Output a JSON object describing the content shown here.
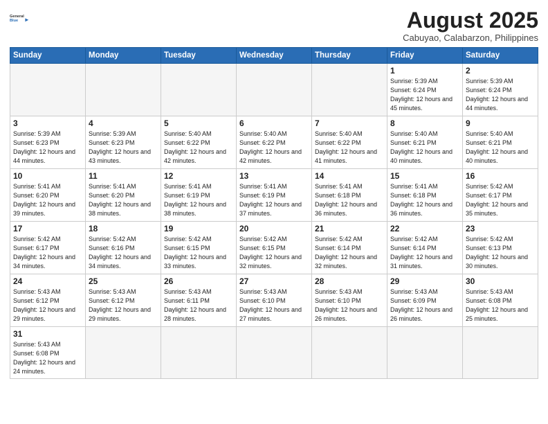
{
  "header": {
    "logo_general": "General",
    "logo_blue": "Blue",
    "title": "August 2025",
    "subtitle": "Cabuyao, Calabarzon, Philippines"
  },
  "weekdays": [
    "Sunday",
    "Monday",
    "Tuesday",
    "Wednesday",
    "Thursday",
    "Friday",
    "Saturday"
  ],
  "weeks": [
    [
      {
        "day": "",
        "info": ""
      },
      {
        "day": "",
        "info": ""
      },
      {
        "day": "",
        "info": ""
      },
      {
        "day": "",
        "info": ""
      },
      {
        "day": "",
        "info": ""
      },
      {
        "day": "1",
        "info": "Sunrise: 5:39 AM\nSunset: 6:24 PM\nDaylight: 12 hours\nand 45 minutes."
      },
      {
        "day": "2",
        "info": "Sunrise: 5:39 AM\nSunset: 6:24 PM\nDaylight: 12 hours\nand 44 minutes."
      }
    ],
    [
      {
        "day": "3",
        "info": "Sunrise: 5:39 AM\nSunset: 6:23 PM\nDaylight: 12 hours\nand 44 minutes."
      },
      {
        "day": "4",
        "info": "Sunrise: 5:39 AM\nSunset: 6:23 PM\nDaylight: 12 hours\nand 43 minutes."
      },
      {
        "day": "5",
        "info": "Sunrise: 5:40 AM\nSunset: 6:22 PM\nDaylight: 12 hours\nand 42 minutes."
      },
      {
        "day": "6",
        "info": "Sunrise: 5:40 AM\nSunset: 6:22 PM\nDaylight: 12 hours\nand 42 minutes."
      },
      {
        "day": "7",
        "info": "Sunrise: 5:40 AM\nSunset: 6:22 PM\nDaylight: 12 hours\nand 41 minutes."
      },
      {
        "day": "8",
        "info": "Sunrise: 5:40 AM\nSunset: 6:21 PM\nDaylight: 12 hours\nand 40 minutes."
      },
      {
        "day": "9",
        "info": "Sunrise: 5:40 AM\nSunset: 6:21 PM\nDaylight: 12 hours\nand 40 minutes."
      }
    ],
    [
      {
        "day": "10",
        "info": "Sunrise: 5:41 AM\nSunset: 6:20 PM\nDaylight: 12 hours\nand 39 minutes."
      },
      {
        "day": "11",
        "info": "Sunrise: 5:41 AM\nSunset: 6:20 PM\nDaylight: 12 hours\nand 38 minutes."
      },
      {
        "day": "12",
        "info": "Sunrise: 5:41 AM\nSunset: 6:19 PM\nDaylight: 12 hours\nand 38 minutes."
      },
      {
        "day": "13",
        "info": "Sunrise: 5:41 AM\nSunset: 6:19 PM\nDaylight: 12 hours\nand 37 minutes."
      },
      {
        "day": "14",
        "info": "Sunrise: 5:41 AM\nSunset: 6:18 PM\nDaylight: 12 hours\nand 36 minutes."
      },
      {
        "day": "15",
        "info": "Sunrise: 5:41 AM\nSunset: 6:18 PM\nDaylight: 12 hours\nand 36 minutes."
      },
      {
        "day": "16",
        "info": "Sunrise: 5:42 AM\nSunset: 6:17 PM\nDaylight: 12 hours\nand 35 minutes."
      }
    ],
    [
      {
        "day": "17",
        "info": "Sunrise: 5:42 AM\nSunset: 6:17 PM\nDaylight: 12 hours\nand 34 minutes."
      },
      {
        "day": "18",
        "info": "Sunrise: 5:42 AM\nSunset: 6:16 PM\nDaylight: 12 hours\nand 34 minutes."
      },
      {
        "day": "19",
        "info": "Sunrise: 5:42 AM\nSunset: 6:15 PM\nDaylight: 12 hours\nand 33 minutes."
      },
      {
        "day": "20",
        "info": "Sunrise: 5:42 AM\nSunset: 6:15 PM\nDaylight: 12 hours\nand 32 minutes."
      },
      {
        "day": "21",
        "info": "Sunrise: 5:42 AM\nSunset: 6:14 PM\nDaylight: 12 hours\nand 32 minutes."
      },
      {
        "day": "22",
        "info": "Sunrise: 5:42 AM\nSunset: 6:14 PM\nDaylight: 12 hours\nand 31 minutes."
      },
      {
        "day": "23",
        "info": "Sunrise: 5:42 AM\nSunset: 6:13 PM\nDaylight: 12 hours\nand 30 minutes."
      }
    ],
    [
      {
        "day": "24",
        "info": "Sunrise: 5:43 AM\nSunset: 6:12 PM\nDaylight: 12 hours\nand 29 minutes."
      },
      {
        "day": "25",
        "info": "Sunrise: 5:43 AM\nSunset: 6:12 PM\nDaylight: 12 hours\nand 29 minutes."
      },
      {
        "day": "26",
        "info": "Sunrise: 5:43 AM\nSunset: 6:11 PM\nDaylight: 12 hours\nand 28 minutes."
      },
      {
        "day": "27",
        "info": "Sunrise: 5:43 AM\nSunset: 6:10 PM\nDaylight: 12 hours\nand 27 minutes."
      },
      {
        "day": "28",
        "info": "Sunrise: 5:43 AM\nSunset: 6:10 PM\nDaylight: 12 hours\nand 26 minutes."
      },
      {
        "day": "29",
        "info": "Sunrise: 5:43 AM\nSunset: 6:09 PM\nDaylight: 12 hours\nand 26 minutes."
      },
      {
        "day": "30",
        "info": "Sunrise: 5:43 AM\nSunset: 6:08 PM\nDaylight: 12 hours\nand 25 minutes."
      }
    ],
    [
      {
        "day": "31",
        "info": "Sunrise: 5:43 AM\nSunset: 6:08 PM\nDaylight: 12 hours\nand 24 minutes."
      },
      {
        "day": "",
        "info": ""
      },
      {
        "day": "",
        "info": ""
      },
      {
        "day": "",
        "info": ""
      },
      {
        "day": "",
        "info": ""
      },
      {
        "day": "",
        "info": ""
      },
      {
        "day": "",
        "info": ""
      }
    ]
  ]
}
